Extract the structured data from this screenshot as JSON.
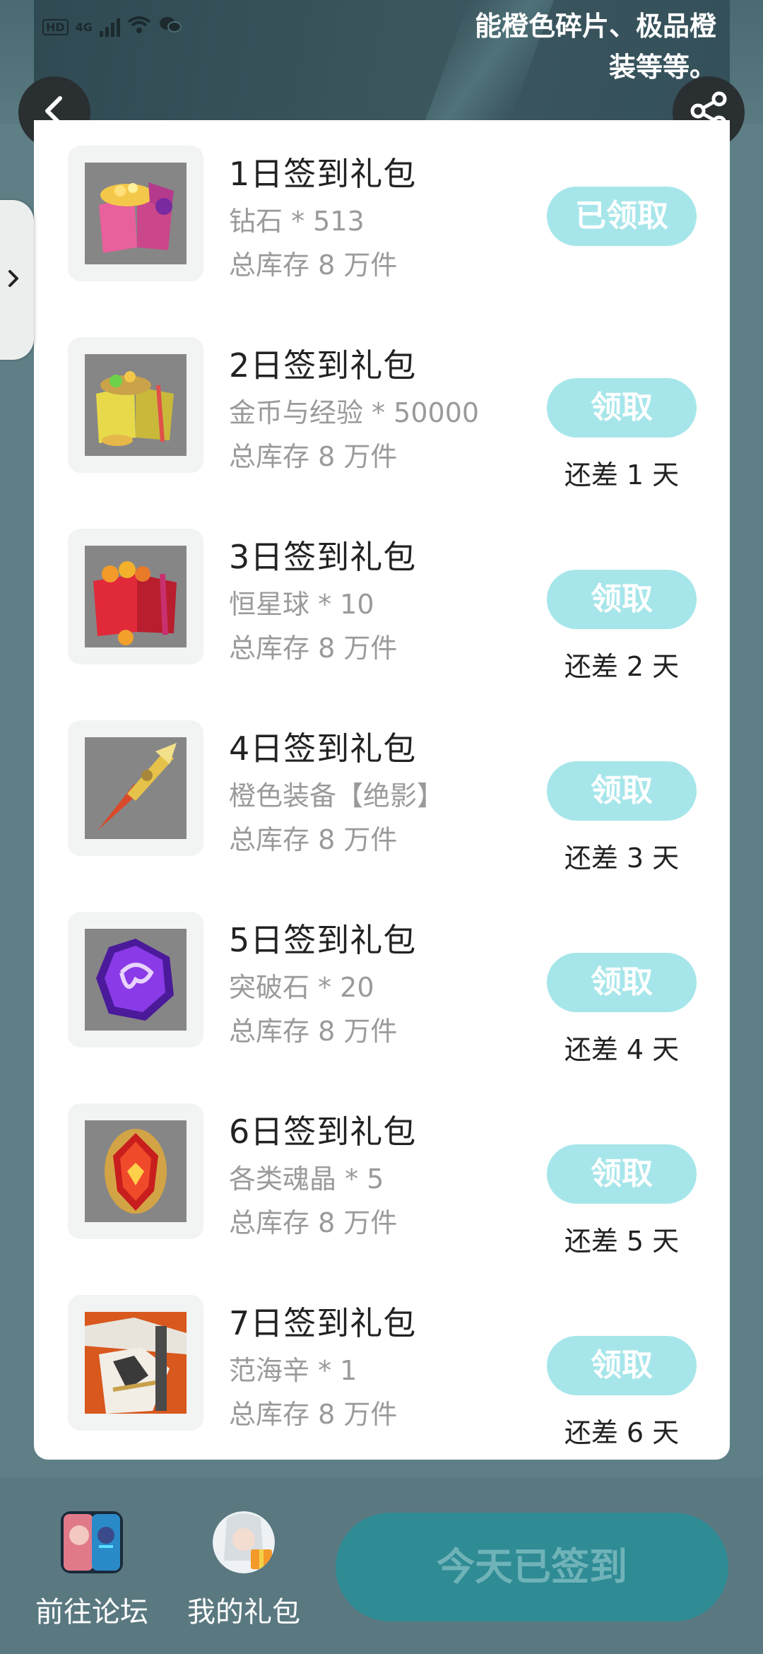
{
  "status_bar": {
    "network": "HD",
    "network_type": "4G"
  },
  "banner": {
    "text_line1": "能橙色碎片、极品橙",
    "text_line2": "装等等。"
  },
  "gifts": [
    {
      "title": "1日签到礼包",
      "desc": "钻石 * 513",
      "stock": "总库存 8 万件",
      "button": "已领取",
      "remain": "",
      "icon": "pink-gift-box-diamonds-icon"
    },
    {
      "title": "2日签到礼包",
      "desc": "金币与经验 * 50000",
      "stock": "总库存 8 万件",
      "button": "领取",
      "remain": "还差 1 天",
      "icon": "yellow-gift-box-coins-icon"
    },
    {
      "title": "3日签到礼包",
      "desc": "恒星球 * 10",
      "stock": "总库存 8 万件",
      "button": "领取",
      "remain": "还差 2 天",
      "icon": "red-gift-box-orbs-icon"
    },
    {
      "title": "4日签到礼包",
      "desc": "橙色装备【绝影】",
      "stock": "总库存 8 万件",
      "button": "领取",
      "remain": "还差 3 天",
      "icon": "golden-spear-icon"
    },
    {
      "title": "5日签到礼包",
      "desc": "突破石 * 20",
      "stock": "总库存 8 万件",
      "button": "领取",
      "remain": "还差 4 天",
      "icon": "purple-breakthrough-stone-icon"
    },
    {
      "title": "6日签到礼包",
      "desc": "各类魂晶 * 5",
      "stock": "总库存 8 万件",
      "button": "领取",
      "remain": "还差 5 天",
      "icon": "red-soul-crystal-icon"
    },
    {
      "title": "7日签到礼包",
      "desc": "范海辛 * 1",
      "stock": "总库存 8 万件",
      "button": "领取",
      "remain": "还差 6 天",
      "icon": "van-helsing-character-icon"
    }
  ],
  "bottom": {
    "forum_label": "前往论坛",
    "my_gifts_label": "我的礼包",
    "signed_label": "今天已签到"
  },
  "colors": {
    "claim_button": "#a6e6ea",
    "signed_button": "#2f8b94",
    "bottom_bar": "#5a7880"
  }
}
